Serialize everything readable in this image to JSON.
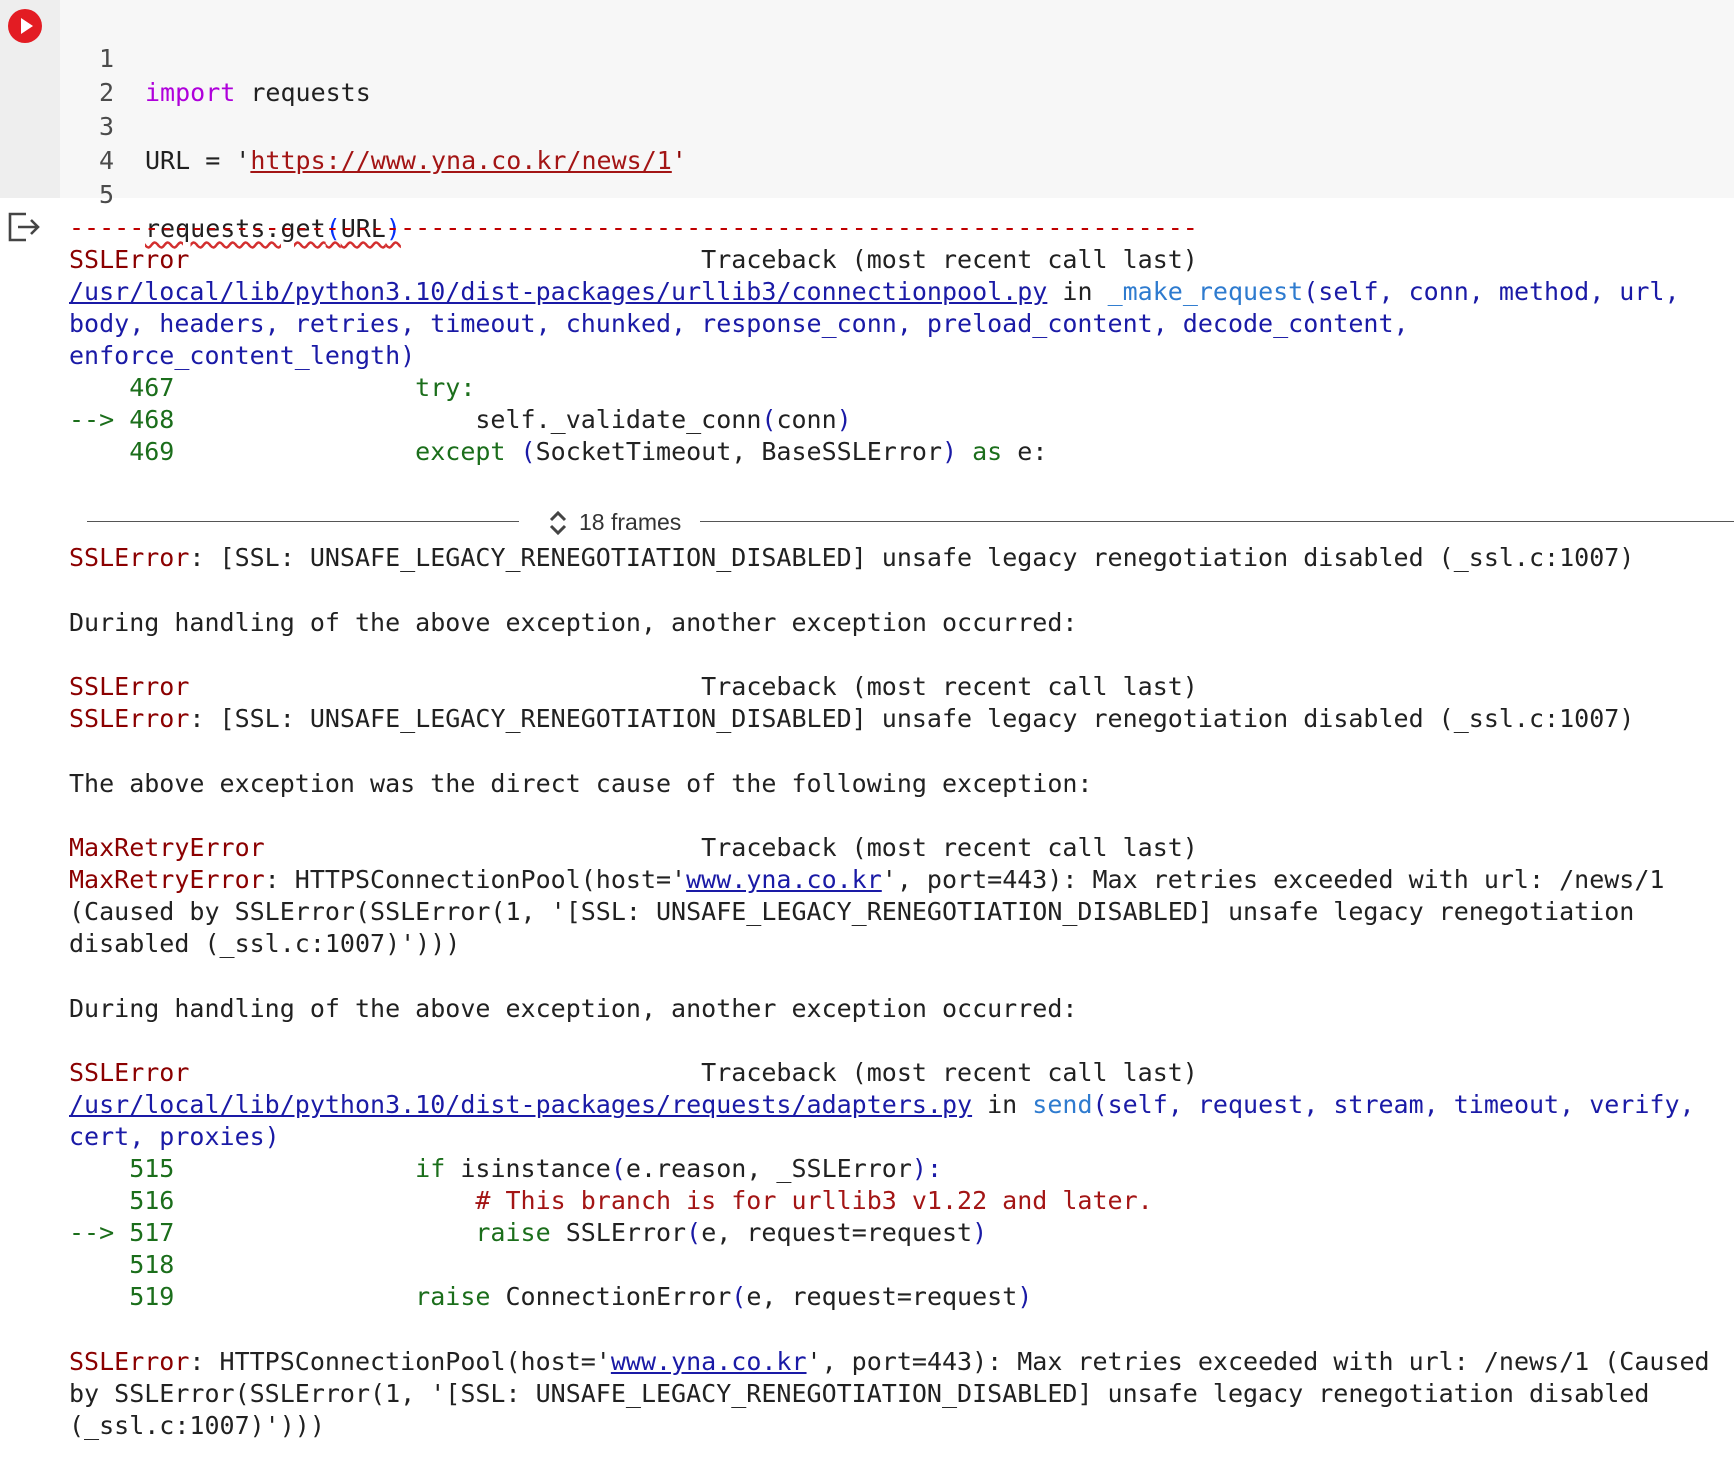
{
  "code_cell": {
    "lines": [
      {
        "num": "1",
        "keyword": "import",
        "rest": " requests"
      },
      {
        "num": "2"
      },
      {
        "num": "3",
        "prefix": "URL = '",
        "url": "https://www.yna.co.kr/news/1",
        "suffix": "'"
      },
      {
        "num": "4"
      },
      {
        "num": "5",
        "call": "requests.get",
        "open": "(",
        "arg": "URL",
        "close": ")"
      }
    ]
  },
  "output": {
    "dashes": "---------------------------------------------------------------------------",
    "tb1": {
      "exc": "SSLError",
      "header": "                                  Traceback (most recent call last)",
      "file": "/usr/local/lib/python3.10/dist-packages/urllib3/connectionpool.py",
      "in": " in ",
      "func": "_make_request",
      "sig1": "(self, conn, method, url,",
      "sig2": "body, headers, retries, timeout, chunked, response_conn, preload_content, decode_content,",
      "sig3": "enforce_content_length)",
      "l467_num": "    467",
      "l467_code": "                try:",
      "l468_arrow": "--> 468",
      "l468_a": "                    self.",
      "l468_b": "_validate_conn",
      "l468_c": "(",
      "l468_d": "conn",
      "l468_e": ")",
      "l469_num": "    469",
      "l469_kw": "                except ",
      "l469_p1": "(",
      "l469_body": "SocketTimeout, BaseSSLError",
      "l469_p2": ")",
      "l469_as": " as ",
      "l469_e": "e:"
    },
    "frames_label": "18 frames",
    "err1_exc": "SSLError",
    "err1_msg": ": [SSL: UNSAFE_LEGACY_RENEGOTIATION_DISABLED] unsafe legacy renegotiation disabled (_ssl.c:1007)",
    "during1": "During handling of the above exception, another exception occurred:",
    "tb2_exc": "SSLError",
    "tb2_header": "                                  Traceback (most recent call last)",
    "err2_exc": "SSLError",
    "err2_msg": ": [SSL: UNSAFE_LEGACY_RENEGOTIATION_DISABLED] unsafe legacy renegotiation disabled (_ssl.c:1007)",
    "direct_cause": "The above exception was the direct cause of the following exception:",
    "tb3_exc": "MaxRetryError",
    "tb3_header": "                             Traceback (most recent call last)",
    "max_exc": "MaxRetryError",
    "max_a": ": HTTPSConnectionPool(host='",
    "max_host": "www.yna.co.kr",
    "max_b": "', port=443): Max retries exceeded with url: /news/1",
    "max_c": "(Caused by SSLError(SSLError(1, '[SSL: UNSAFE_LEGACY_RENEGOTIATION_DISABLED] unsafe legacy renegotiation",
    "max_d": "disabled (_ssl.c:1007)')))",
    "during2": "During handling of the above exception, another exception occurred:",
    "tb4": {
      "exc": "SSLError",
      "header": "                                  Traceback (most recent call last)",
      "file": "/usr/local/lib/python3.10/dist-packages/requests/adapters.py",
      "in": " in ",
      "func": "send",
      "sig1": "(self, request, stream, timeout, verify,",
      "sig2": "cert, proxies)",
      "l515_num": "    515",
      "l515_kw": "                if ",
      "l515_a": "isinstance",
      "l515_b": "(",
      "l515_c": "e.reason, _SSLError",
      "l515_d": "):",
      "l516_num": "    516",
      "l516_comment": "                    # This branch is for urllib3 v1.22 and later.",
      "l517_arrow": "--> 517",
      "l517_kw": "                    raise ",
      "l517_a": "SSLError",
      "l517_b": "(",
      "l517_c": "e, request=request",
      "l517_d": ")",
      "l518_num": "    518",
      "l519_num": "    519",
      "l519_kw": "                raise ",
      "l519_a": "ConnectionError",
      "l519_b": "(",
      "l519_c": "e, request=request",
      "l519_d": ")"
    },
    "final_exc": "SSLError",
    "final_a": ": HTTPSConnectionPool(host='",
    "final_host": "www.yna.co.kr",
    "final_b": "', port=443): Max retries exceeded with url: /news/1 (Caused",
    "final_c": "by SSLError(SSLError(1, '[SSL: UNSAFE_LEGACY_RENEGOTIATION_DISABLED] unsafe legacy renegotiation disabled",
    "final_d": "(_ssl.c:1007)')))"
  },
  "colors": {
    "run_button": "#e31c23",
    "error_red": "#8b0000",
    "line_green": "#1b6e1b",
    "link_blue": "#1a1aa6",
    "keyword_purple": "#af00db"
  }
}
